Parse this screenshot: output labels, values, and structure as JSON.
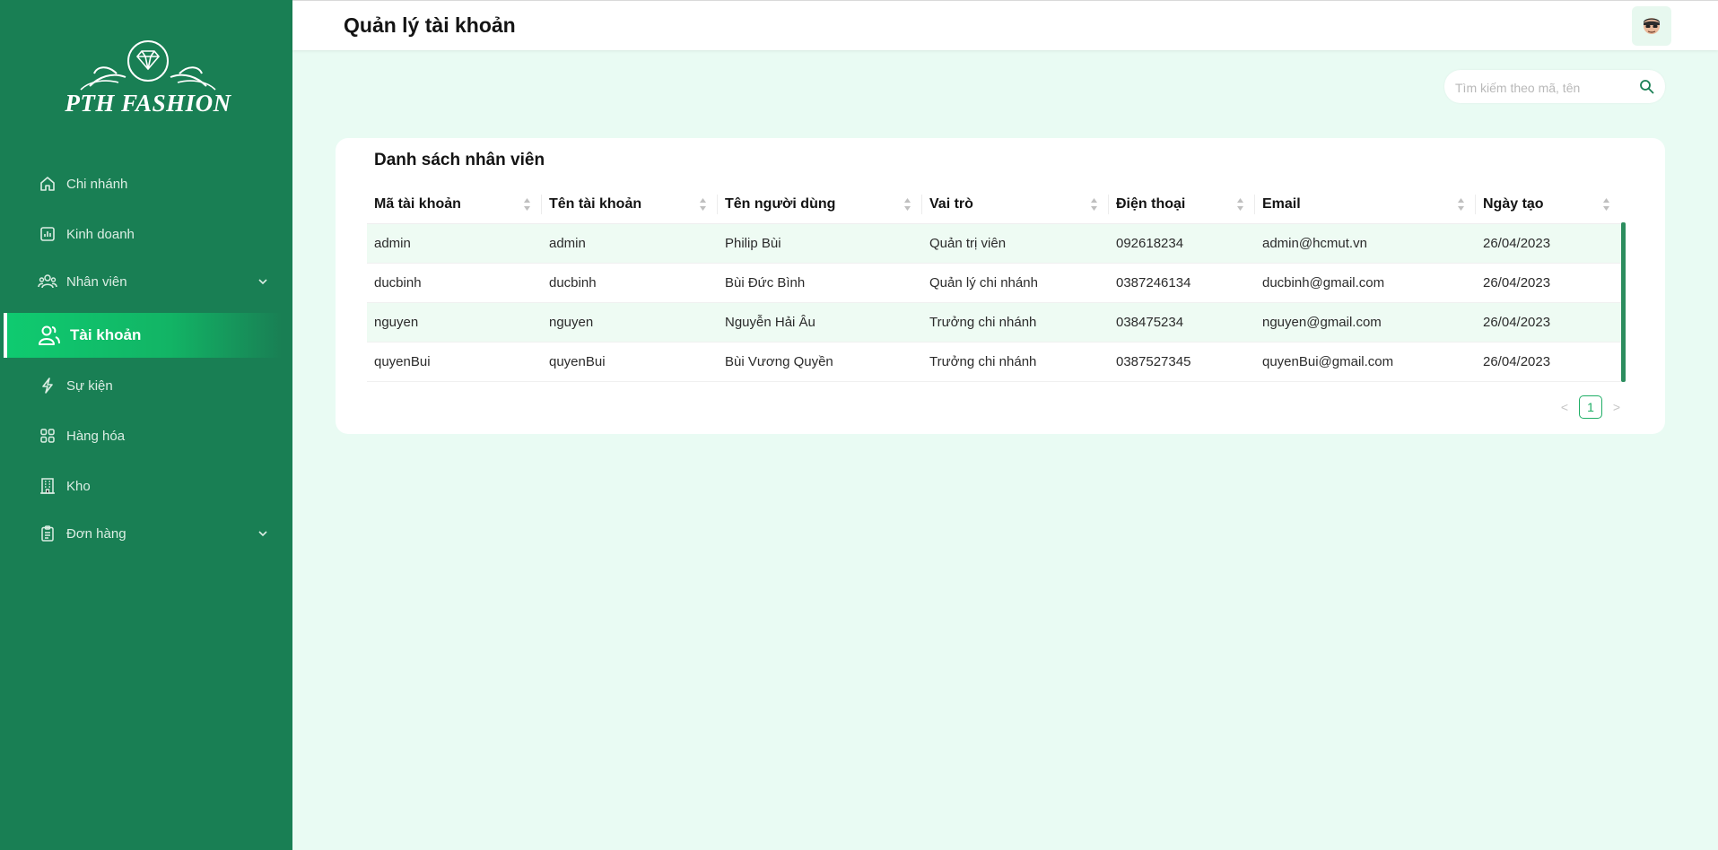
{
  "brand": {
    "logo_text": "PTH FASHION"
  },
  "sidebar": {
    "items": [
      {
        "label": "Chi nhánh",
        "icon": "home-icon"
      },
      {
        "label": "Kinh doanh",
        "icon": "chart-icon"
      },
      {
        "label": "Nhân viên",
        "icon": "users-icon",
        "expandable": true
      },
      {
        "label": "Tài khoản",
        "icon": "account-icon",
        "active": true
      },
      {
        "label": "Sự kiện",
        "icon": "bolt-icon"
      },
      {
        "label": "Hàng hóa",
        "icon": "grid-icon"
      },
      {
        "label": "Kho",
        "icon": "building-icon"
      },
      {
        "label": "Đơn hàng",
        "icon": "clipboard-icon",
        "expandable": true
      }
    ]
  },
  "header": {
    "title": "Quản lý tài khoản"
  },
  "search": {
    "placeholder": "Tìm kiếm theo mã, tên"
  },
  "table": {
    "title": "Danh sách nhân viên",
    "columns": [
      "Mã tài khoản",
      "Tên tài khoản",
      "Tên người dùng",
      "Vai trò",
      "Điện thoại",
      "Email",
      "Ngày tạo"
    ],
    "rows": [
      [
        "admin",
        "admin",
        "Philip Bùi",
        "Quản trị viên",
        "092618234",
        "admin@hcmut.vn",
        "26/04/2023"
      ],
      [
        "ducbinh",
        "ducbinh",
        "Bùi Đức Bình",
        "Quản lý chi nhánh",
        "0387246134",
        "ducbinh@gmail.com",
        "26/04/2023"
      ],
      [
        "nguyen",
        "nguyen",
        "Nguyễn Hải Âu",
        "Trưởng chi nhánh",
        "038475234",
        "nguyen@gmail.com",
        "26/04/2023"
      ],
      [
        "quyenBui",
        "quyenBui",
        "Bùi Vương Quyền",
        "Trưởng chi nhánh",
        "0387527345",
        "quyenBui@gmail.com",
        "26/04/2023"
      ]
    ]
  },
  "pagination": {
    "current": "1",
    "prev": "<",
    "next": ">"
  },
  "colors": {
    "sidebar": "#197f54",
    "accent": "#12c56e",
    "page_bg": "#e9fbf3",
    "row_alt": "#eefbf3"
  }
}
